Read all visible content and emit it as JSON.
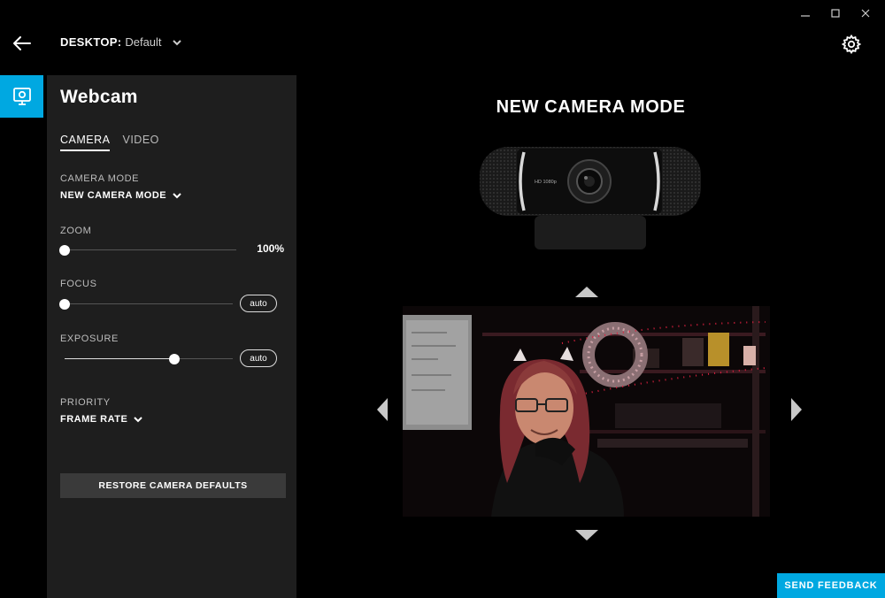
{
  "window": {
    "minimize": "—",
    "maximize": "☐",
    "close": "✕"
  },
  "header": {
    "profile_label": "DESKTOP:",
    "profile_value": "Default"
  },
  "panel": {
    "title": "Webcam",
    "tabs": [
      {
        "label": "CAMERA",
        "active": true
      },
      {
        "label": "VIDEO",
        "active": false
      }
    ],
    "camera_mode": {
      "label": "CAMERA MODE",
      "value": "NEW CAMERA MODE"
    },
    "zoom": {
      "label": "ZOOM",
      "value_text": "100%",
      "level": 0.0
    },
    "focus": {
      "label": "FOCUS",
      "auto_label": "auto",
      "level": 0.0
    },
    "exposure": {
      "label": "EXPOSURE",
      "auto_label": "auto",
      "level": 0.65
    },
    "priority": {
      "label": "PRIORITY",
      "value": "FRAME RATE"
    },
    "restore_label": "RESTORE CAMERA DEFAULTS"
  },
  "main": {
    "mode_title": "NEW CAMERA MODE",
    "camera_badge": "HD 1080p"
  },
  "feedback_label": "SEND FEEDBACK",
  "colors": {
    "accent": "#00a8e1",
    "panel": "#1e1e1e",
    "background": "#000000"
  }
}
